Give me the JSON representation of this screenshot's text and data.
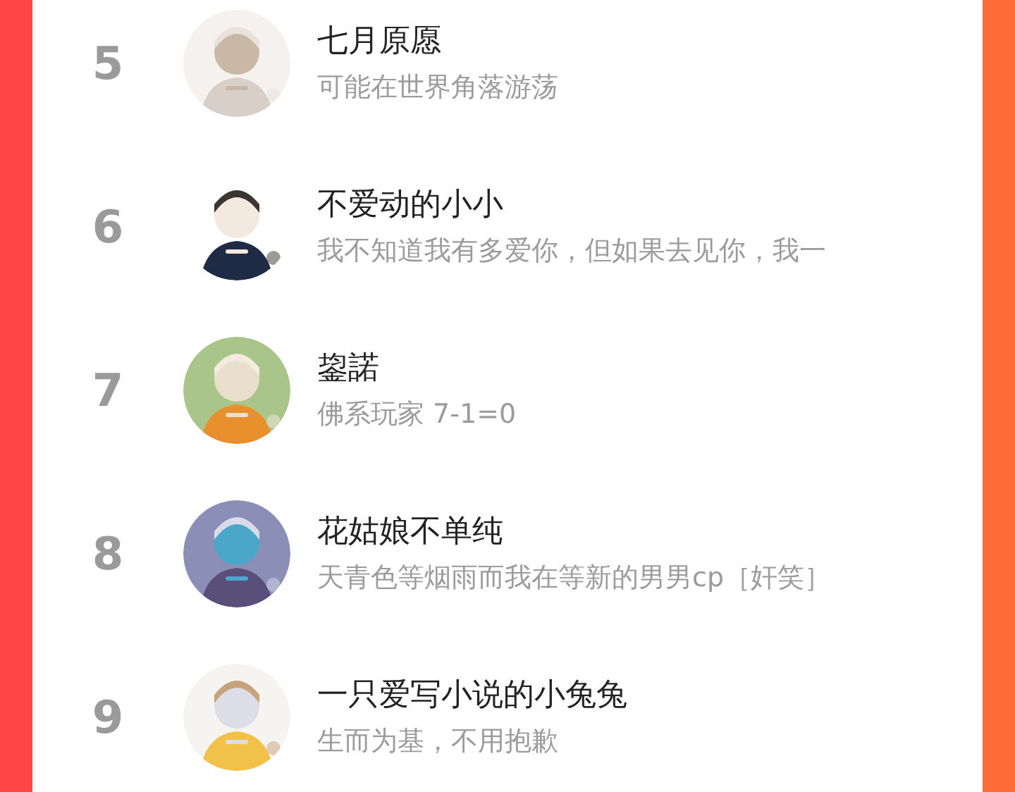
{
  "ranking": [
    {
      "rank": "5",
      "name": "七月原愿",
      "bio": "可能在世界角落游荡"
    },
    {
      "rank": "6",
      "name": "不爱动的小小",
      "bio": "我不知道我有多爱你，但如果去见你，我一"
    },
    {
      "rank": "7",
      "name": "鋆諾",
      "bio": "佛系玩家 7-1=0"
    },
    {
      "rank": "8",
      "name": "花姑娘不单纯",
      "bio": "天青色等烟雨而我在等新的男男cp［奸笑］"
    },
    {
      "rank": "9",
      "name": "一只爱写小说的小兔兔",
      "bio": "生而为基，不用抱歉"
    }
  ]
}
